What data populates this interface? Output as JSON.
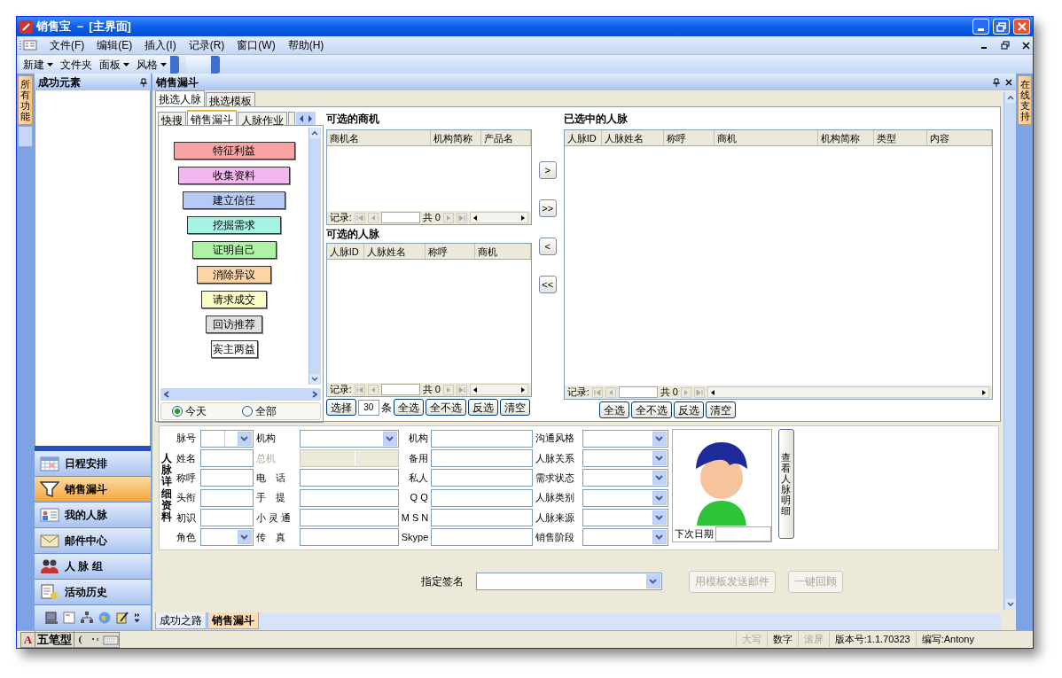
{
  "window": {
    "title": "销售宝 － [主界面]"
  },
  "menu": [
    "文件(F)",
    "编辑(E)",
    "插入(I)",
    "记录(R)",
    "窗口(W)",
    "帮助(H)"
  ],
  "toolbar": [
    {
      "label": "新建",
      "dropdown": true
    },
    {
      "label": "文件夹",
      "dropdown": false
    },
    {
      "label": "面板",
      "dropdown": true
    },
    {
      "label": "风格",
      "dropdown": true
    }
  ],
  "left_tab": "所有功能",
  "right_tab": "在线支持",
  "sidebar": {
    "title": "成功元素",
    "nav": [
      {
        "label": "日程安排",
        "selected": false,
        "kind": "calendar"
      },
      {
        "label": "销售漏斗",
        "selected": true,
        "kind": "funnel"
      },
      {
        "label": "我的人脉",
        "selected": false,
        "kind": "contact"
      },
      {
        "label": "邮件中心",
        "selected": false,
        "kind": "mail"
      },
      {
        "label": "人 脉 组",
        "selected": false,
        "kind": "group"
      },
      {
        "label": "活动历史",
        "selected": false,
        "kind": "history"
      }
    ]
  },
  "panel": {
    "title": "销售漏斗",
    "tabs": [
      {
        "label": "挑选人脉",
        "selected": true
      },
      {
        "label": "挑选模板",
        "selected": false
      }
    ],
    "sub_tabs": [
      {
        "label": "快搜",
        "selected": false
      },
      {
        "label": "销售漏斗",
        "selected": true
      },
      {
        "label": "人脉作业",
        "selected": false
      }
    ],
    "funnel": [
      {
        "label": "特征利益",
        "color": "#f8a4a4"
      },
      {
        "label": "收集资料",
        "color": "#f4b6ee"
      },
      {
        "label": "建立信任",
        "color": "#b6caf6"
      },
      {
        "label": "挖掘需求",
        "color": "#a6f2e4"
      },
      {
        "label": "证明自己",
        "color": "#aef2a6"
      },
      {
        "label": "消除异议",
        "color": "#fcd4a6"
      },
      {
        "label": "请求成交",
        "color": "#fcfcc6"
      },
      {
        "label": "回访推荐",
        "color": "#e0e0e0"
      },
      {
        "label": "宾主两益",
        "color": "#ffffff"
      }
    ],
    "date_filter": [
      {
        "label": "今天",
        "selected": true
      },
      {
        "label": "全部",
        "selected": false
      }
    ],
    "opportunities": {
      "title": "可选的商机",
      "columns": [
        "商机名",
        "机构简称",
        "产品名"
      ],
      "record_label": "记录:",
      "total": "共 0"
    },
    "candidates": {
      "title": "可选的人脉",
      "columns": [
        "人脉ID",
        "人脉姓名",
        "称呼",
        "商机"
      ],
      "record_label": "记录:",
      "total": "共 0"
    },
    "select_bar": {
      "label": "选择",
      "count": "30",
      "unit": "条",
      "buttons": [
        "全选",
        "全不选",
        "反选",
        "清空"
      ]
    },
    "transfer_buttons": [
      ">",
      ">>",
      "<",
      "<<"
    ],
    "selected_people": {
      "title": "已选中的人脉",
      "columns": [
        "人脉ID",
        "人脉姓名",
        "称呼",
        "商机",
        "机构简称",
        "类型",
        "内容"
      ],
      "record_label": "记录:",
      "total": "共 0",
      "buttons": [
        "全选",
        "全不选",
        "反选",
        "清空"
      ]
    }
  },
  "detail": {
    "title": "人脉详细资料",
    "columns": [
      [
        {
          "label": "脉号",
          "kind": "split-select"
        },
        {
          "label": "姓名",
          "kind": "text"
        },
        {
          "label": "称呼",
          "kind": "text"
        },
        {
          "label": "头衔",
          "kind": "text"
        },
        {
          "label": "初识",
          "kind": "text"
        },
        {
          "label": "角色",
          "kind": "select"
        }
      ],
      [
        {
          "label": "机构",
          "kind": "select"
        },
        {
          "label": "总机",
          "kind": "disabled"
        },
        {
          "label": "电　话",
          "kind": "text"
        },
        {
          "label": "手　提",
          "kind": "text"
        },
        {
          "label": "小 灵 通",
          "kind": "text"
        },
        {
          "label": "传　真",
          "kind": "text"
        }
      ],
      [
        {
          "label": "机构",
          "kind": "text"
        },
        {
          "label": "备用",
          "kind": "text"
        },
        {
          "label": "私人",
          "kind": "text"
        },
        {
          "label": "Q Q",
          "kind": "text"
        },
        {
          "label": "M S N",
          "kind": "text"
        },
        {
          "label": "Skype",
          "kind": "text"
        }
      ],
      [
        {
          "label": "沟通风格",
          "kind": "select"
        },
        {
          "label": "人脉关系",
          "kind": "select"
        },
        {
          "label": "需求状态",
          "kind": "select"
        },
        {
          "label": "人脉类别",
          "kind": "select"
        },
        {
          "label": "人脉来源",
          "kind": "select"
        },
        {
          "label": "销售阶段",
          "kind": "select"
        }
      ]
    ],
    "next_date_label": "下次日期",
    "view_button": "查看人脉明细",
    "signature_label": "指定签名",
    "actions": [
      {
        "label": "用模板发送邮件",
        "disabled": true
      },
      {
        "label": "一键回顾",
        "disabled": true
      }
    ]
  },
  "bottom_tabs": [
    {
      "label": "成功之路",
      "selected": false
    },
    {
      "label": "销售漏斗",
      "selected": true
    }
  ],
  "ime": {
    "logo": "A",
    "mode": "五笔型"
  },
  "status": [
    {
      "label": "大写",
      "enabled": false
    },
    {
      "label": "数字",
      "enabled": true
    },
    {
      "label": "滚屏",
      "enabled": false
    },
    {
      "label": "版本号:1.1.70323",
      "enabled": true
    },
    {
      "label": "编写:Antony",
      "enabled": true
    }
  ]
}
